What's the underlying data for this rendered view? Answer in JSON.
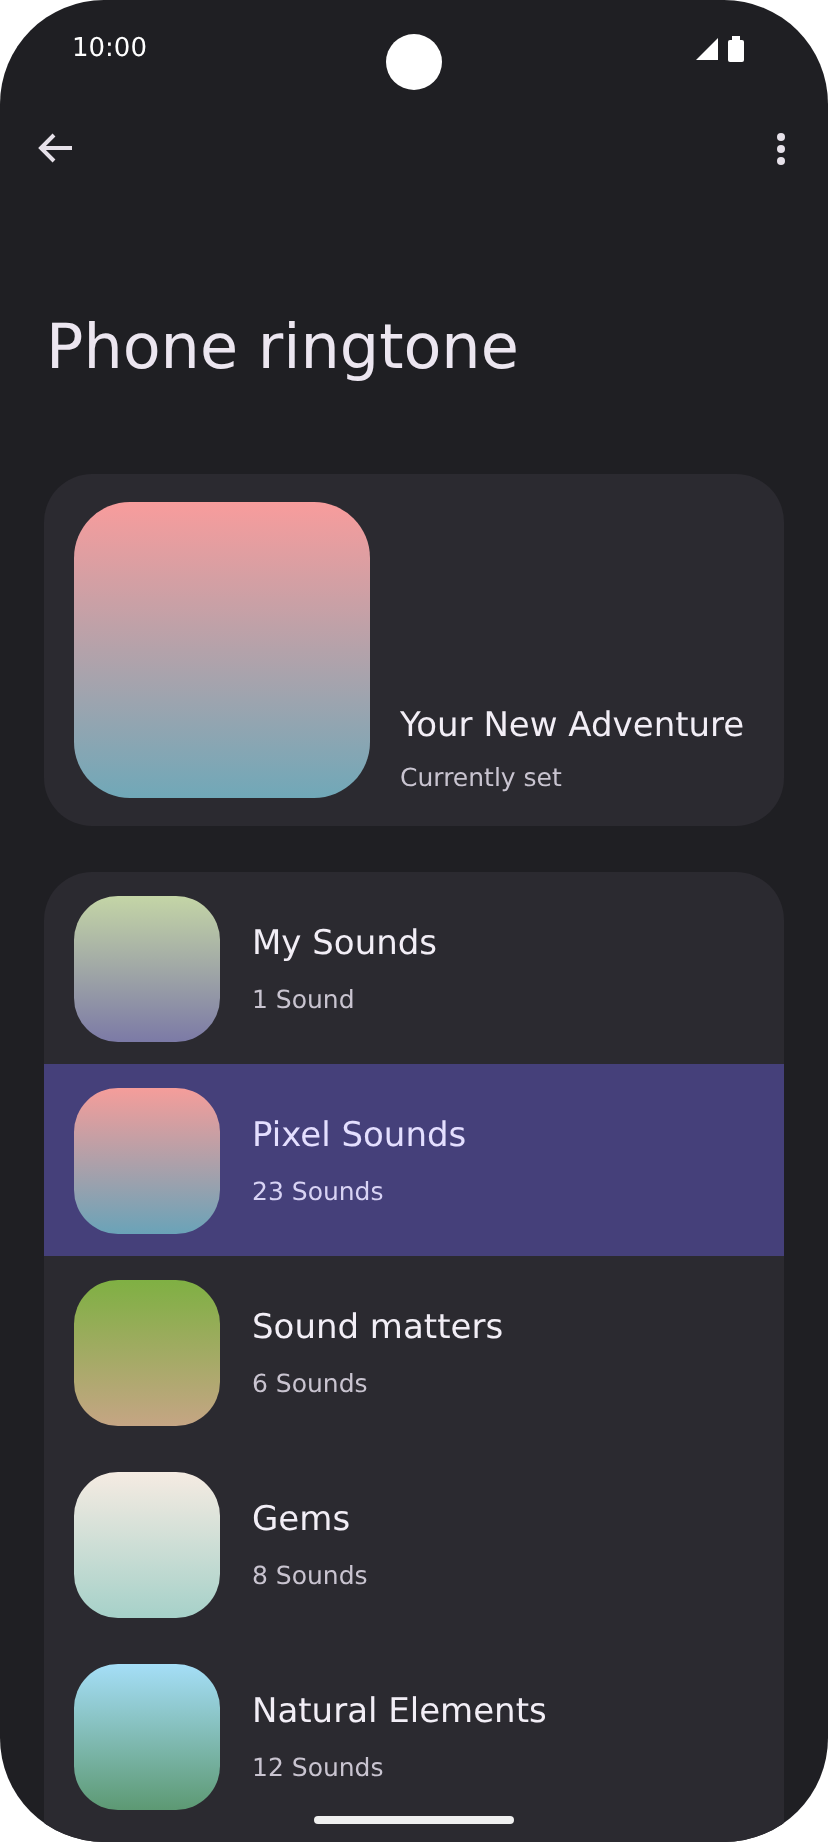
{
  "status_bar": {
    "time": "10:00"
  },
  "title": "Phone ringtone",
  "current": {
    "name": "Your New Adventure",
    "subtitle": "Currently set"
  },
  "categories": [
    {
      "name": "My Sounds",
      "count": "1 Sound",
      "selected": false
    },
    {
      "name": "Pixel Sounds",
      "count": "23 Sounds",
      "selected": true
    },
    {
      "name": "Sound matters",
      "count": "6 Sounds",
      "selected": false
    },
    {
      "name": "Gems",
      "count": "8 Sounds",
      "selected": false
    },
    {
      "name": "Natural Elements",
      "count": "12 Sounds",
      "selected": false
    }
  ]
}
